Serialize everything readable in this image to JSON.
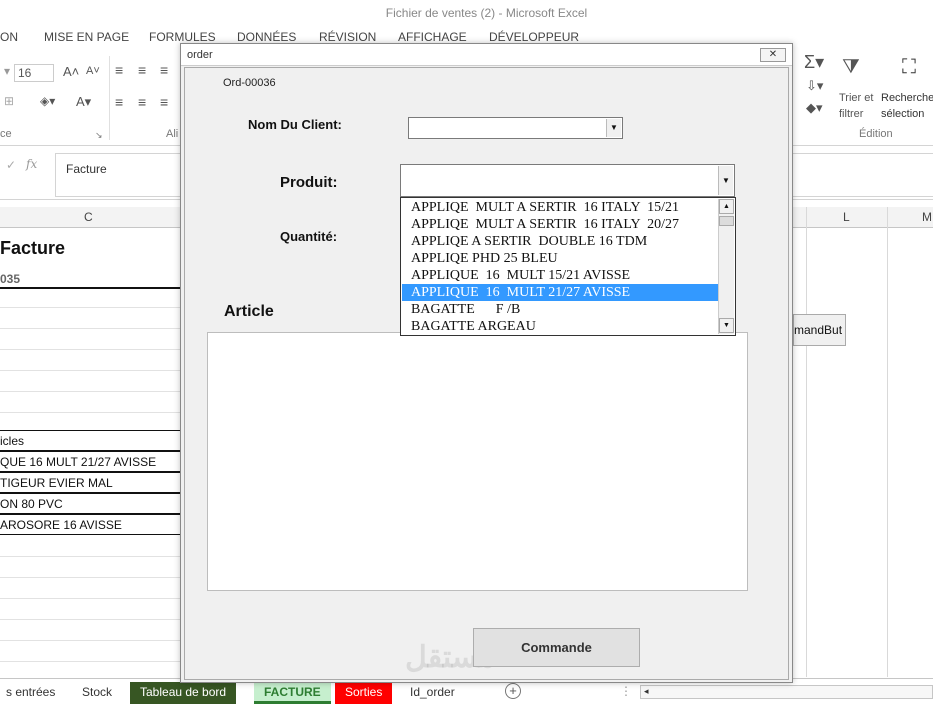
{
  "window_title": "Fichier de ventes (2) - Microsoft Excel",
  "ribbon_tabs": [
    "ON",
    "MISE EN PAGE",
    "FORMULES",
    "DONNÉES",
    "RÉVISION",
    "AFFICHAGE",
    "DÉVELOPPEUR"
  ],
  "ribbon": {
    "font_size": "16",
    "group_police": "ce",
    "group_align": "Ali",
    "sort_filter_1": "Trier et",
    "sort_filter_2": "filtrer",
    "find_1": "Recherche",
    "find_2": "sélection",
    "group_edition": "Édition"
  },
  "formula_bar": {
    "fx": "fx",
    "value": "Facture"
  },
  "columns": [
    "C",
    "L",
    "M"
  ],
  "sheet_cells": {
    "title": "Facture",
    "order_prev": "035",
    "articles_header": "icles",
    "row1": "QUE  16  MULT 21/27 AVISSE",
    "row2": "TIGEUR EVIER MAL",
    "row3": "ON 80 PVC",
    "row4": "AROSORE 16 AVISSE"
  },
  "sheet_button": "mandBut",
  "sheet_tabs": [
    {
      "label": "s entrées"
    },
    {
      "label": "Stock"
    },
    {
      "label": "Tableau de bord",
      "color": "#375623"
    },
    {
      "label": "FACTURE",
      "color": "#c6efce"
    },
    {
      "label": "Sorties",
      "color": "#ff0000"
    },
    {
      "label": "Id_order"
    }
  ],
  "dialog": {
    "title": "order",
    "order_id": "Ord-00036",
    "client_label": "Nom Du Client:",
    "product_label": "Produit:",
    "quantity_label": "Quantité:",
    "article_label": "Article",
    "submit_label": "Commande",
    "product_options": [
      "APPLIQE  MULT A SERTIR  16 ITALY  15/21",
      "APPLIQE  MULT A SERTIR  16 ITALY  20/27",
      "APPLIQE A SERTIR  DOUBLE 16 TDM",
      "APPLIQE PHD 25 BLEU",
      "APPLIQUE  16  MULT 15/21 AVISSE",
      "APPLIQUE  16  MULT 21/27 AVISSE",
      "BAGATTE      F /B",
      "BAGATTE ARGEAU"
    ],
    "selected_option_index": 5
  },
  "icons": [
    "close-icon",
    "dropdown-arrow-icon",
    "autosum-icon",
    "sort-filter-icon",
    "find-binoculars-icon",
    "fx-icon",
    "add-sheet-icon"
  ],
  "watermark": "مستقل"
}
